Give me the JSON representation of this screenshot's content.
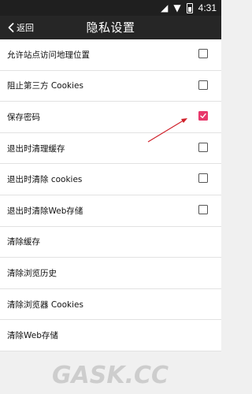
{
  "status_bar": {
    "time": "4:31"
  },
  "app_bar": {
    "back_label": "返回",
    "title": "隐私设置"
  },
  "settings": [
    {
      "label": "允许站点访问地理位置",
      "has_checkbox": true,
      "checked": false
    },
    {
      "label": "阻止第三方 Cookies",
      "has_checkbox": true,
      "checked": false
    },
    {
      "label": "保存密码",
      "has_checkbox": true,
      "checked": true
    },
    {
      "label": "退出时清理缓存",
      "has_checkbox": true,
      "checked": false
    },
    {
      "label": "退出时清除 cookies",
      "has_checkbox": true,
      "checked": false
    },
    {
      "label": "退出时清除Web存储",
      "has_checkbox": true,
      "checked": false
    },
    {
      "label": "清除缓存",
      "has_checkbox": false
    },
    {
      "label": "清除浏览历史",
      "has_checkbox": false
    },
    {
      "label": "清除浏览器 Cookies",
      "has_checkbox": false
    },
    {
      "label": "清除Web存储",
      "has_checkbox": false
    }
  ],
  "watermark": {
    "text": "GASK.CC"
  },
  "colors": {
    "accent": "#e8396c",
    "arrow": "#d0202a",
    "app_bar": "#262626",
    "status_bar": "#1f1f1f"
  }
}
